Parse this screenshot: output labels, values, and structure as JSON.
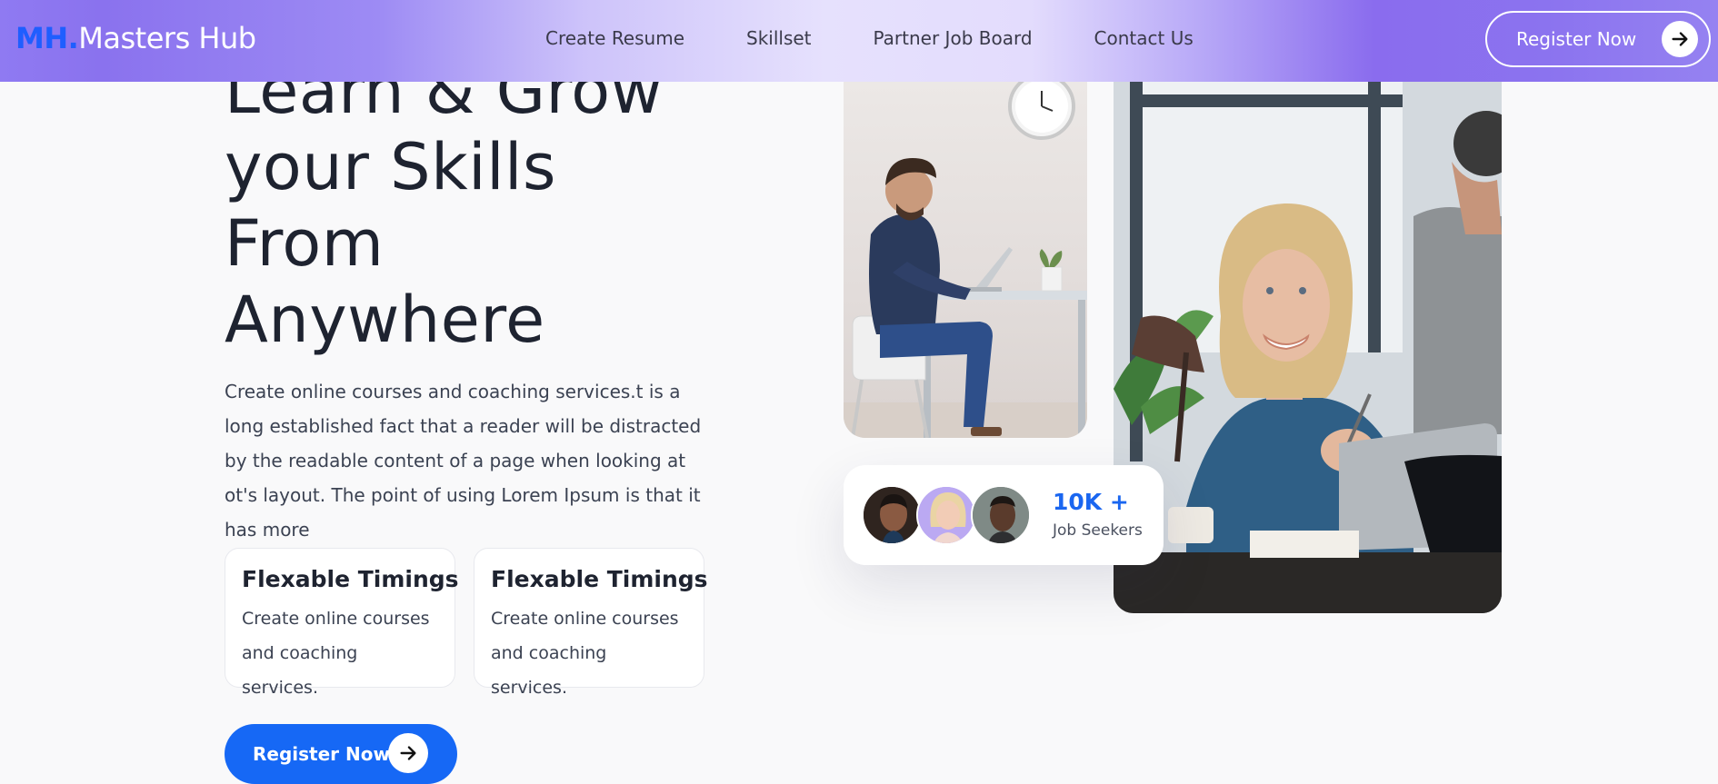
{
  "header": {
    "logo_mark": "MH.",
    "logo_name": "Masters Hub",
    "nav": [
      {
        "label": "Create Resume"
      },
      {
        "label": "Skillset"
      },
      {
        "label": "Partner Job Board"
      },
      {
        "label": "Contact Us"
      }
    ],
    "cta_label": "Register Now",
    "cta_icon": "arrow-right-icon"
  },
  "hero": {
    "title_lines": [
      "Learn & Grow",
      "your Skills",
      "From",
      "Anywhere"
    ],
    "description": "Create online courses and coaching services.t is a long established fact that a reader will be distracted by the readable content of a page when looking at ot's layout. The point of using Lorem Ipsum is that it has more",
    "features": [
      {
        "title": "Flexable Timings",
        "text": "Create online courses and coaching services."
      },
      {
        "title": "Flexable Timings",
        "text": "Create online courses and coaching services."
      }
    ],
    "cta_label": "Register Now",
    "cta_icon": "arrow-right-icon"
  },
  "stats": {
    "number": "10K +",
    "label": "Job Seekers"
  },
  "colors": {
    "accent_blue": "#1668f5",
    "header_purple": "#8a6cee",
    "text_dark": "#1e2330"
  }
}
